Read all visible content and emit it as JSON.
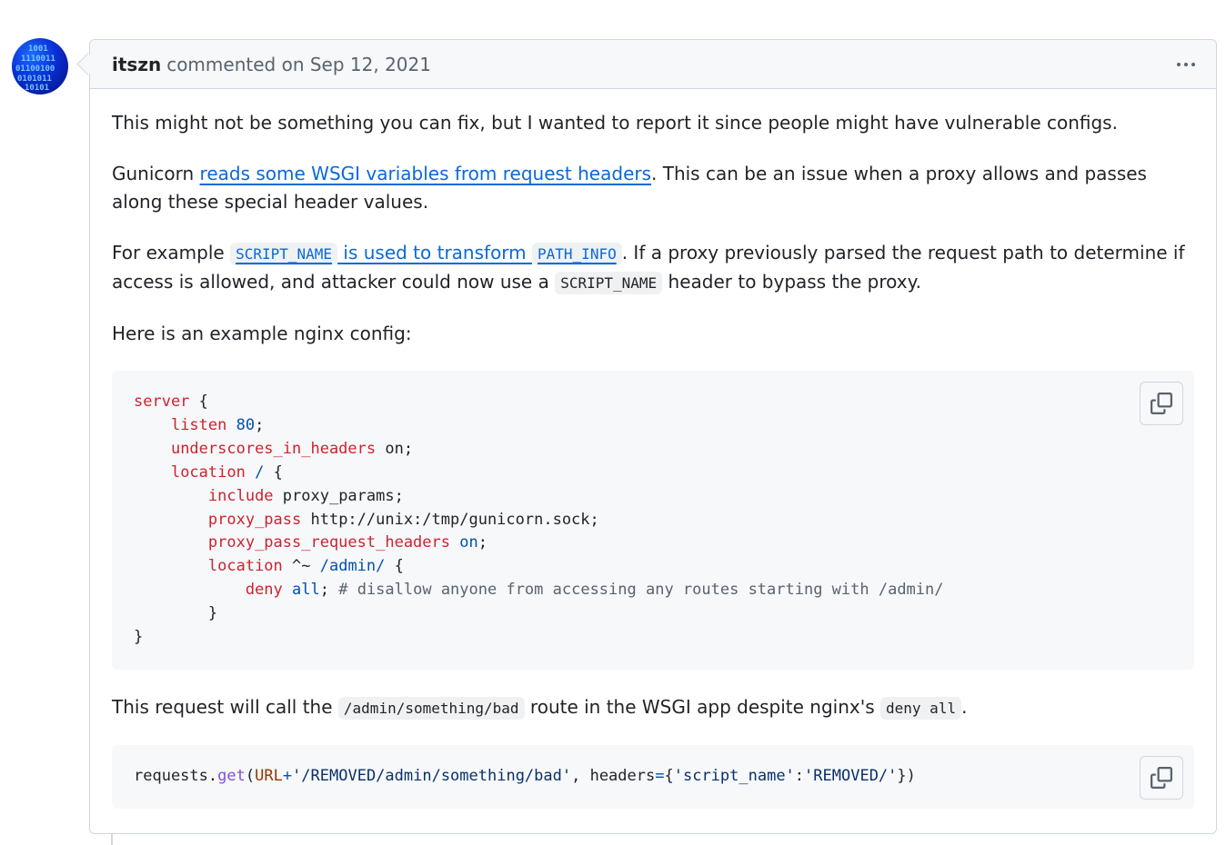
{
  "comment": {
    "author": "itszn",
    "meta": "commented on Sep 12, 2021",
    "avatar_alt": "itszn avatar"
  },
  "body": {
    "p1": "This might not be something you can fix, but I wanted to report it since people might have vulnerable configs.",
    "p2_prefix": "Gunicorn ",
    "p2_link": "reads some WSGI variables from request headers",
    "p2_suffix": ". This can be an issue when a proxy allows and passes along these special header values.",
    "p3_prefix": "For example ",
    "p3_code1": "SCRIPT_NAME",
    "p3_link_text": " is used to transform ",
    "p3_code2": "PATH_INFO",
    "p3_mid": ". If a proxy previously parsed the request path to determine if access is allowed, and attacker could now use a ",
    "p3_code3": "SCRIPT_NAME",
    "p3_suffix": " header to bypass the proxy.",
    "p4": "Here is an example nginx config:",
    "p5_prefix": "This request will call the ",
    "p5_code1": "/admin/something/bad",
    "p5_mid": " route in the WSGI app despite nginx's ",
    "p5_code2": "deny all",
    "p5_suffix": "."
  },
  "code_block_1": {
    "language": "nginx",
    "lines": [
      "server {",
      "    listen 80;",
      "    underscores_in_headers on;",
      "    location / {",
      "        include proxy_params;",
      "        proxy_pass http://unix:/tmp/gunicorn.sock;",
      "        proxy_pass_request_headers on;",
      "        location ^~ /admin/ {",
      "            deny all; # disallow anyone from accessing any routes starting with /admin/",
      "        }",
      "}"
    ]
  },
  "code_block_2": {
    "language": "python",
    "lines": [
      "requests.get(URL+'/REMOVED/admin/something/bad', headers={'script_name':'REMOVED/'})"
    ]
  },
  "icons": {
    "kebab": "kebab-horizontal-icon",
    "copy": "copy-icon"
  },
  "colors": {
    "keyword": "#cf222e",
    "constant": "#0550ae",
    "comment": "#59636e",
    "string": "#0a3069",
    "function": "#8250df",
    "variable": "#953800",
    "link": "#0969da"
  }
}
